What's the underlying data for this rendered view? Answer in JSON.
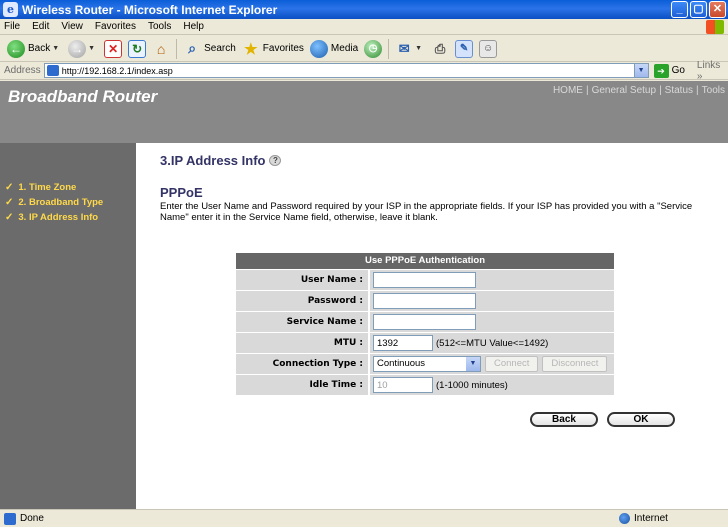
{
  "window": {
    "title": "Wireless Router - Microsoft Internet Explorer"
  },
  "menu": [
    "File",
    "Edit",
    "View",
    "Favorites",
    "Tools",
    "Help"
  ],
  "toolbar": {
    "back": "Back",
    "search": "Search",
    "favorites": "Favorites",
    "media": "Media"
  },
  "address": {
    "label": "Address",
    "url": "http://192.168.2.1/index.asp",
    "go": "Go",
    "links": "Links"
  },
  "header": {
    "brand": "Broadband Router",
    "nav": [
      "HOME",
      "General Setup",
      "Status",
      "Tools"
    ]
  },
  "sidebar": {
    "items": [
      {
        "label": "1. Time Zone"
      },
      {
        "label": "2. Broadband Type"
      },
      {
        "label": "3. IP Address Info"
      }
    ]
  },
  "main": {
    "section_title": "3.IP Address Info",
    "pppoe_title": "PPPoE",
    "description": "Enter the User Name and Password required by your ISP in the appropriate fields. If your ISP has provided you with a \"Service Name\" enter it in the Service Name field, otherwise, leave it blank."
  },
  "form": {
    "header": "Use PPPoE Authentication",
    "username_label": "User Name :",
    "username_value": "",
    "password_label": "Password :",
    "password_value": "",
    "service_label": "Service Name :",
    "service_value": "",
    "mtu_label": "MTU :",
    "mtu_value": "1392",
    "mtu_hint": "(512<=MTU Value<=1492)",
    "conn_label": "Connection Type :",
    "conn_value": "Continuous",
    "connect_label": "Connect",
    "disconnect_label": "Disconnect",
    "idle_label": "Idle Time :",
    "idle_value": "10",
    "idle_hint": "(1-1000 minutes)"
  },
  "actions": {
    "back": "Back",
    "ok": "OK"
  },
  "status": {
    "text": "Done",
    "zone": "Internet"
  }
}
